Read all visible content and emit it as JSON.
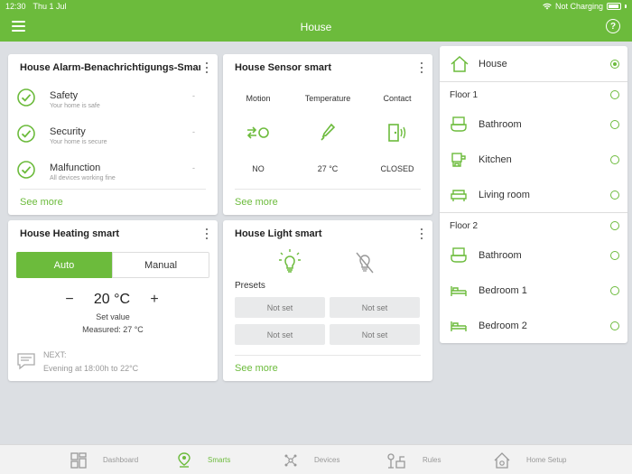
{
  "status_bar": {
    "time": "12:30",
    "date": "Thu 1 Jul",
    "charging": "Not Charging"
  },
  "header": {
    "title": "House"
  },
  "alarm_card": {
    "title": "House Alarm-Benachrichtigungs-Smar",
    "rows": [
      {
        "name": "Safety",
        "sub": "Your home is safe",
        "dash": "-"
      },
      {
        "name": "Security",
        "sub": "Your home is secure",
        "dash": "-"
      },
      {
        "name": "Malfunction",
        "sub": "All devices working fine",
        "dash": "-"
      }
    ],
    "see_more": "See more"
  },
  "sensor_card": {
    "title": "House Sensor smart",
    "cols": [
      {
        "label": "Motion",
        "value": "NO",
        "icon": "motion-icon"
      },
      {
        "label": "Temperature",
        "value": "27 °C",
        "icon": "thermometer-icon"
      },
      {
        "label": "Contact",
        "value": "CLOSED",
        "icon": "door-contact-icon"
      }
    ],
    "see_more": "See more"
  },
  "heating_card": {
    "title": "House Heating smart",
    "auto": "Auto",
    "manual": "Manual",
    "minus": "−",
    "plus": "+",
    "temperature": "20 °C",
    "set_value": "Set value",
    "measured": "Measured:  27 °C",
    "next_label": "NEXT:",
    "next_value": "Evening at 18:00h to 22°C"
  },
  "light_card": {
    "title": "House Light smart",
    "presets_label": "Presets",
    "presets": [
      "Not set",
      "Not set",
      "Not set",
      "Not set"
    ],
    "see_more": "See more"
  },
  "rooms_panel": {
    "house": "House",
    "floors": [
      {
        "name": "Floor 1",
        "rooms": [
          "Bathroom",
          "Kitchen",
          "Living room"
        ]
      },
      {
        "name": "Floor 2",
        "rooms": [
          "Bathroom",
          "Bedroom 1",
          "Bedroom 2"
        ]
      }
    ]
  },
  "bottom_nav": [
    {
      "label": "Dashboard",
      "icon": "dashboard-icon"
    },
    {
      "label": "Smarts",
      "icon": "smarts-icon",
      "active": true
    },
    {
      "label": "Devices",
      "icon": "devices-icon"
    },
    {
      "label": "Rules",
      "icon": "rules-icon"
    },
    {
      "label": "Home Setup",
      "icon": "home-setup-icon"
    }
  ],
  "colors": {
    "accent": "#6cbb3c",
    "background": "#dcdfe3"
  }
}
